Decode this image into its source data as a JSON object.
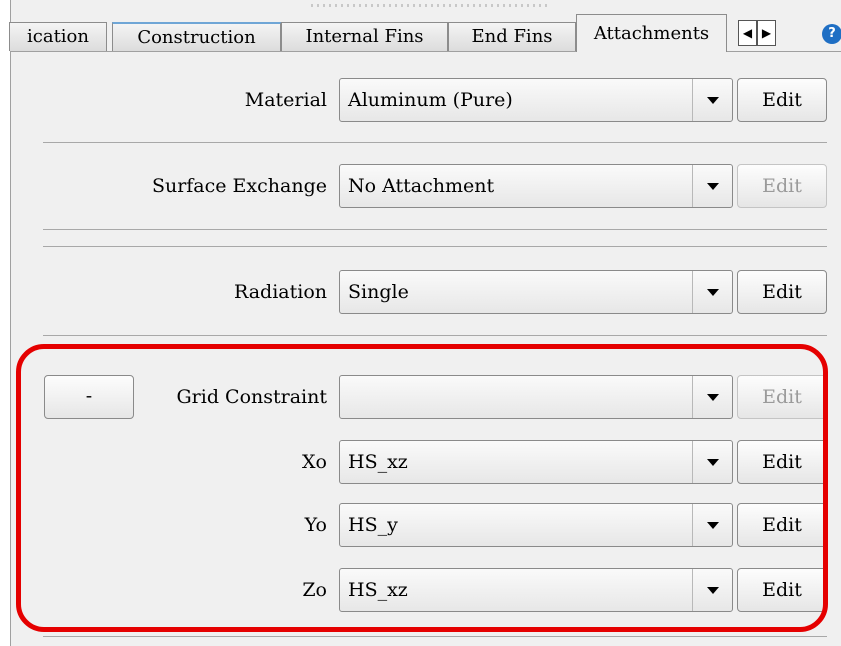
{
  "tabs": [
    {
      "label": "Location",
      "visible_text": "ication",
      "active": false
    },
    {
      "label": "Construction",
      "active": false
    },
    {
      "label": "Internal Fins",
      "active": false
    },
    {
      "label": "End Fins",
      "active": false
    },
    {
      "label": "Attachments",
      "active": true
    }
  ],
  "tab_nav": {
    "prev_symbol": "◀",
    "next_symbol": "▶"
  },
  "help_icon": {
    "glyph": "?",
    "color": "#1f6fc4"
  },
  "rows": [
    {
      "label": "Material",
      "value": "Aluminum (Pure)",
      "button": "Edit",
      "button_enabled": true
    },
    {
      "label": "Surface Exchange",
      "value": "No Attachment",
      "button": "Edit",
      "button_enabled": false
    },
    {
      "label": "Radiation",
      "value": "Single",
      "button": "Edit",
      "button_enabled": true
    },
    {
      "label": "Grid Constraint",
      "value": "",
      "button": "Edit",
      "button_enabled": false
    },
    {
      "label": "Xo",
      "value": "HS_xz",
      "button": "Edit",
      "button_enabled": true
    },
    {
      "label": "Yo",
      "value": "HS_y",
      "button": "Edit",
      "button_enabled": true
    },
    {
      "label": "Zo",
      "value": "HS_xz",
      "button": "Edit",
      "button_enabled": true
    }
  ],
  "remove_button": {
    "label": "-"
  },
  "colors": {
    "highlight": "#e50000",
    "panel": "#f0f0f0",
    "disabled_text": "#9a9a9a"
  }
}
